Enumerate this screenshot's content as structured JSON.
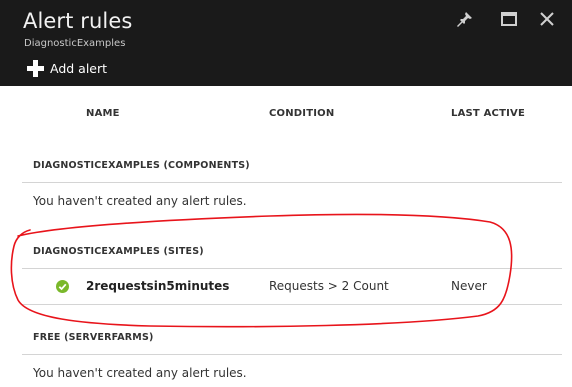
{
  "blade": {
    "title": "Alert rules",
    "subtitle": "DiagnosticExamples"
  },
  "toolbar": {
    "add_alert_label": "Add alert"
  },
  "window_controls": [
    "pin-icon",
    "maximize-icon",
    "close-icon"
  ],
  "columns": [
    "NAME",
    "CONDITION",
    "LAST ACTIVE"
  ],
  "sections": [
    {
      "title": "DIAGNOSTICEXAMPLES (COMPONENTS)",
      "empty_message": "You haven't created any alert rules."
    },
    {
      "title": "DIAGNOSTICEXAMPLES (SITES)",
      "rules": [
        {
          "status_icon": "check-circle-icon",
          "name": "2requestsin5minutes",
          "condition": "Requests > 2 Count",
          "last_active": "Never"
        }
      ]
    },
    {
      "title": "FREE (SERVERFARMS)",
      "empty_message": "You haven't created any alert rules."
    }
  ],
  "colors": {
    "header_bg": "#1a1a1a",
    "status_ok": "#7ab82b",
    "annotation": "#e8141b"
  }
}
